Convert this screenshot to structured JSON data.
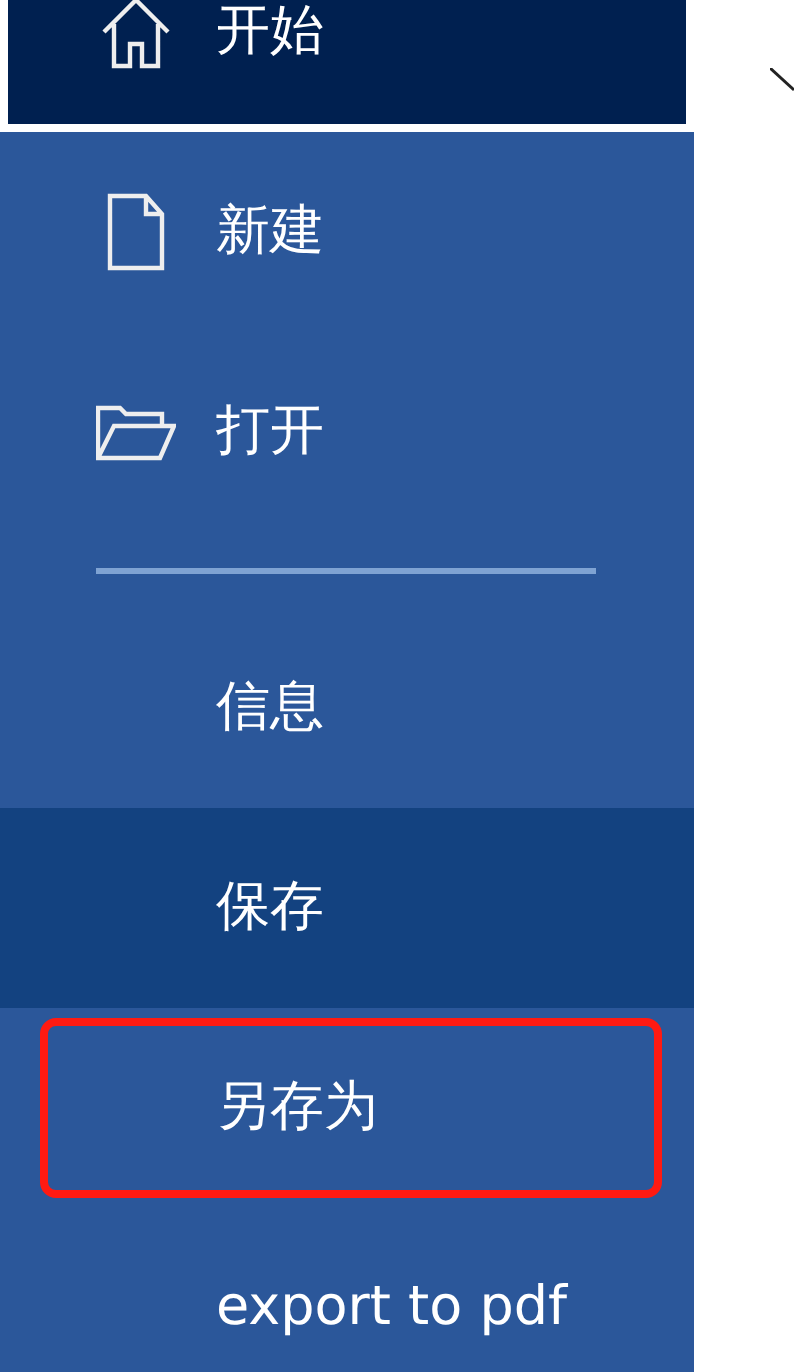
{
  "menu": [
    {
      "kind": "home",
      "label": "开始",
      "selected": true,
      "hovered": false,
      "highlighted": false
    },
    {
      "kind": "new",
      "label": "新建",
      "selected": false,
      "hovered": false,
      "highlighted": false
    },
    {
      "kind": "open",
      "label": "打开",
      "selected": false,
      "hovered": false,
      "highlighted": false
    },
    {
      "kind": "divider"
    },
    {
      "kind": "text",
      "label": "信息",
      "selected": false,
      "hovered": false,
      "highlighted": false
    },
    {
      "kind": "text",
      "label": "保存",
      "selected": false,
      "hovered": true,
      "highlighted": false
    },
    {
      "kind": "text",
      "label": "另存为",
      "selected": false,
      "hovered": false,
      "highlighted": true
    },
    {
      "kind": "text",
      "label": "export to pdf",
      "selected": false,
      "hovered": false,
      "highlighted": false
    }
  ]
}
